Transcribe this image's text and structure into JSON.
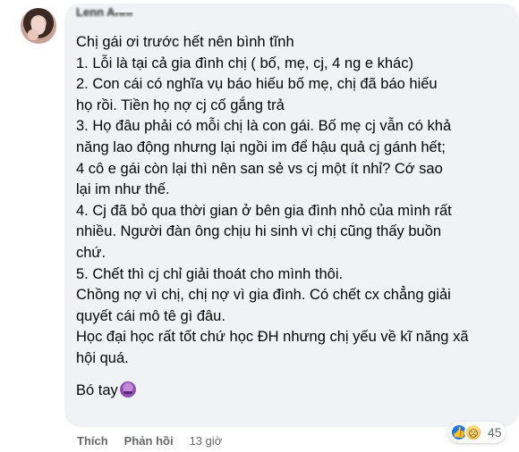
{
  "comment": {
    "author": "Lenn Anhl",
    "lines": [
      "Chị gái ơi trước hết nên bình tĩnh",
      "1. Lỗi là tại cả gia đình chị ( bố, mẹ, cj, 4 ng e khác)",
      "2. Con cái có nghĩa vụ báo hiếu bố mẹ, chị đã báo hiếu",
      "họ rồi. Tiền họ nợ cj cố gắng trả",
      "3. Họ đâu phải có mỗi chị là con gái. Bố mẹ cj vẫn có khả",
      "năng lao động nhưng lại ngồi im để hậu quả cj gánh hết;",
      "4 cô e gái còn lại thì nên san sẻ vs cj một ít nhỉ? Cớ sao",
      "lại im như thế.",
      "4. Cj đã bỏ qua thời gian ở bên gia đình nhỏ của mình rất",
      "nhiều. Người đàn ông chịu hi sinh vì chị cũng thấy buồn",
      "chứ.",
      "5. Chết thì cj chỉ giải thoát cho mình thôi.",
      "Chồng nợ vì chị, chị nợ vì gia đình. Có chết cx chẳng giải",
      "quyết cái mô tê gì đâu.",
      "Học đại học rất tốt chứ học ĐH nhưng chị yếu về kĩ năng xã",
      "hội quá."
    ],
    "closing": "Bó tay",
    "closing_emoji": "tired-face-emoji"
  },
  "actions": {
    "like": "Thích",
    "reply": "Phản hồi",
    "time": "13 giờ"
  },
  "reactions": {
    "types": [
      "like-reaction-icon",
      "sad-reaction-icon"
    ],
    "count": "45"
  },
  "colors": {
    "bubble": "#f0f2f5",
    "text": "#050505",
    "meta": "#65676b",
    "like_blue": "#1877f2"
  }
}
